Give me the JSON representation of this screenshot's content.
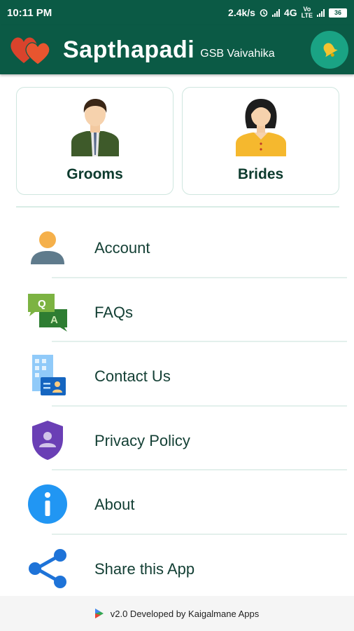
{
  "status_bar": {
    "time": "10:11 PM",
    "network_speed": "2.4k/s",
    "network_type": "4G",
    "battery": "36"
  },
  "app_bar": {
    "title": "Sapthapadi",
    "subtitle": "GSB Vaivahika",
    "logo_icon": "hearts-logo-icon",
    "notification_icon": "bell-icon"
  },
  "cards": [
    {
      "label": "Grooms",
      "icon": "groom-avatar-icon"
    },
    {
      "label": "Brides",
      "icon": "bride-avatar-icon"
    }
  ],
  "menu": [
    {
      "label": "Account",
      "icon": "account-icon"
    },
    {
      "label": "FAQs",
      "icon": "faq-icon"
    },
    {
      "label": "Contact Us",
      "icon": "contact-icon"
    },
    {
      "label": "Privacy Policy",
      "icon": "privacy-shield-icon"
    },
    {
      "label": "About",
      "icon": "info-icon"
    },
    {
      "label": "Share this App",
      "icon": "share-icon"
    }
  ],
  "footer": {
    "text": "v2.0 Developed by Kaigalmane Apps"
  },
  "colors": {
    "primary": "#0b5a45",
    "accent": "#1aa384",
    "card_border": "#cfe6df"
  }
}
